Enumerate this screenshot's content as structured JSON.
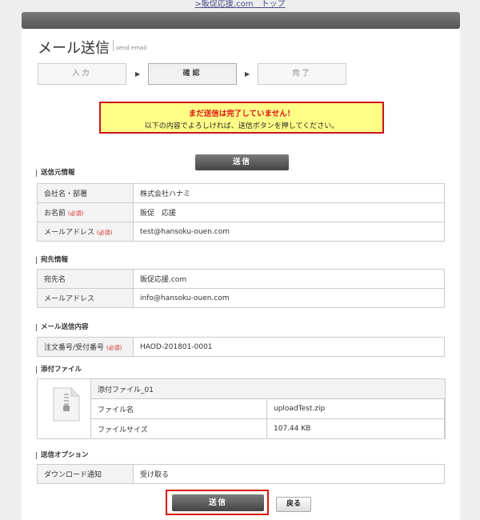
{
  "top_link": ">販促応援.com　トップ",
  "page": {
    "title": "メール送信",
    "subtitle": "send email"
  },
  "steps": [
    "入力",
    "確認",
    "完了"
  ],
  "warning": {
    "title": "まだ送信は完了していません！",
    "text": "以下の内容でよろしければ、送信ボタンを押してください。"
  },
  "send_label": "送信",
  "back_label": "戻る",
  "required_label": "(必須)",
  "sender": {
    "heading": "送信元情報",
    "rows": [
      {
        "label": "会社名・部署",
        "value": "株式会社ハナミ"
      },
      {
        "label": "お名前",
        "value": "販促　応援"
      },
      {
        "label": "メールアドレス",
        "value": "test@hansoku-ouen.com"
      }
    ]
  },
  "recipient": {
    "heading": "宛先情報",
    "rows": [
      {
        "label": "宛先名",
        "value": "販促応援.com"
      },
      {
        "label": "メールアドレス",
        "value": "info@hansoku-ouen.com"
      }
    ]
  },
  "content": {
    "heading": "メール送信内容",
    "rows": [
      {
        "label": "注文番号/受付番号",
        "value": "HAOD-201801-0001"
      }
    ]
  },
  "attachments": {
    "heading": "添付ファイル",
    "file_title": "添付ファイル_01",
    "name_label": "ファイル名",
    "name_value": "uploadTest.zip",
    "size_label": "ファイルサイズ",
    "size_value": "107.44 KB"
  },
  "options": {
    "heading": "送信オプション",
    "rows": [
      {
        "label": "ダウンロード通知",
        "value": "受け取る"
      }
    ]
  }
}
